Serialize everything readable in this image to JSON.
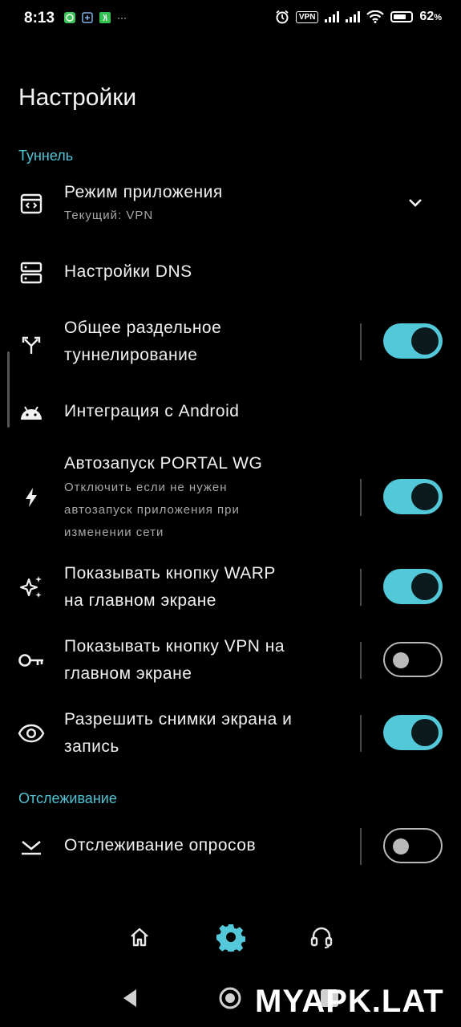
{
  "status_bar": {
    "time": "8:13",
    "app_icons": [
      "whatsapp-icon",
      "app-icon",
      "app-icon"
    ],
    "more": "···",
    "vpn_badge": "VPN",
    "battery_percent": "62",
    "battery_unit": "%"
  },
  "page": {
    "title": "Настройки"
  },
  "sections": {
    "tunnel": "Туннель",
    "tracking": "Отслеживание"
  },
  "settings": {
    "app_mode": {
      "title": "Режим приложения",
      "subtitle": "Текущий: VPN",
      "icon": "app-window-icon"
    },
    "dns": {
      "title": "Настройки DNS",
      "icon": "dns-server-icon"
    },
    "split_tunnel": {
      "title_line1": "Общее раздельное",
      "title_line2": "туннелирование",
      "enabled": true,
      "icon": "split-arrows-icon"
    },
    "android": {
      "title": "Интеграция с Android",
      "icon": "android-icon"
    },
    "autostart": {
      "title": "Автозапуск PORTAL WG",
      "sub_line1": "Отключить если не нужен",
      "sub_line2": "автозапуск приложения при",
      "sub_line3": "изменении сети",
      "enabled": true,
      "icon": "bolt-icon"
    },
    "warp_button": {
      "title_line1": "Показывать кнопку WARP",
      "title_line2": "на главном экране",
      "enabled": true,
      "icon": "sparkles-icon"
    },
    "vpn_button": {
      "title_line1": "Показывать кнопку VPN на",
      "title_line2": "главном экране",
      "enabled": false,
      "icon": "key-icon"
    },
    "screenshots": {
      "title_line1": "Разрешить снимки экрана и",
      "title_line2": "запись",
      "enabled": true,
      "icon": "eye-icon"
    },
    "polling": {
      "title": "Отслеживание опросов",
      "enabled": false,
      "icon": "tracking-icon"
    }
  },
  "bottom_nav": {
    "items": [
      {
        "name": "home",
        "icon": "home-icon",
        "active": false
      },
      {
        "name": "settings",
        "icon": "gear-icon",
        "active": true
      },
      {
        "name": "support",
        "icon": "headset-icon",
        "active": false
      }
    ]
  },
  "watermark": "MYAPK.LAT",
  "colors": {
    "accent": "#53c8d8",
    "section_header": "#4fc4d6",
    "background": "#000000",
    "text": "#f1f1f1",
    "subtext": "#a7a7a7"
  }
}
